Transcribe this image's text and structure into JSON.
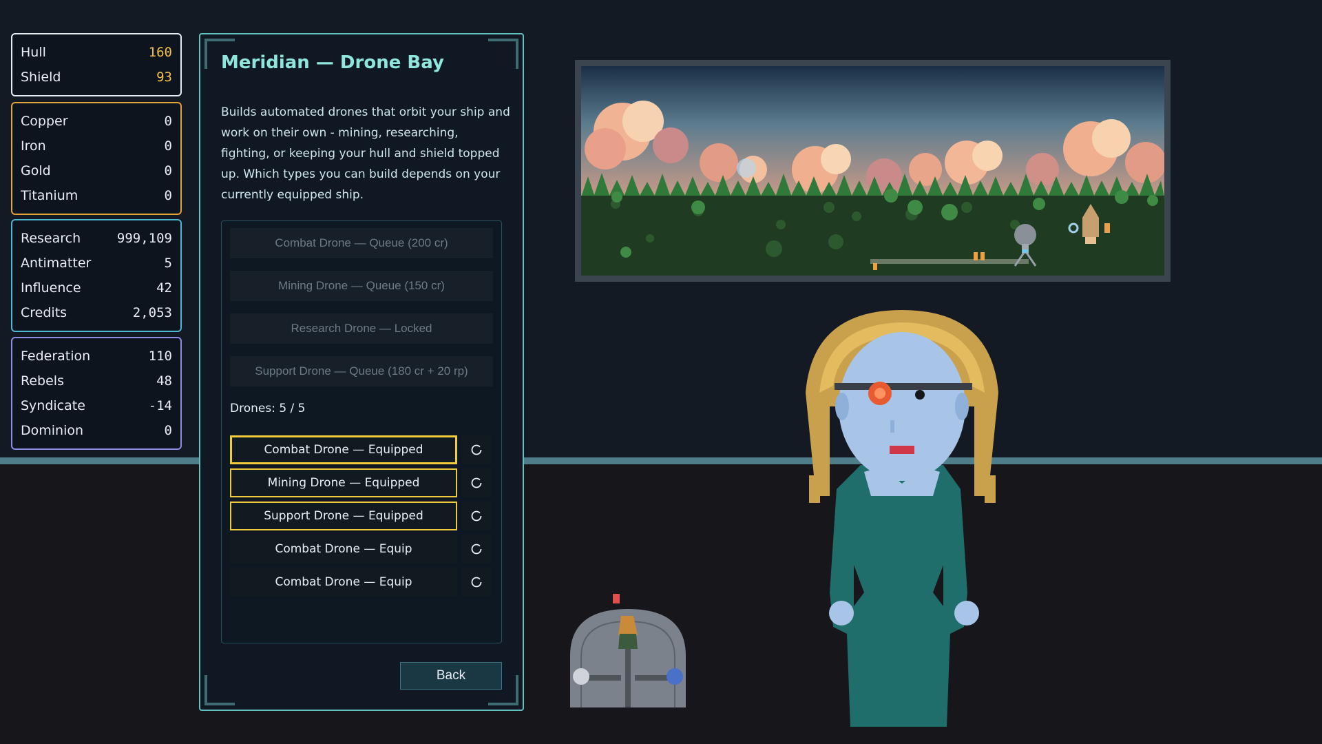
{
  "stats": {
    "hull": [
      {
        "label": "Hull",
        "value": "160"
      },
      {
        "label": "Shield",
        "value": "93"
      }
    ],
    "metals": [
      {
        "label": "Copper",
        "value": "0"
      },
      {
        "label": "Iron",
        "value": "0"
      },
      {
        "label": "Gold",
        "value": "0"
      },
      {
        "label": "Titanium",
        "value": "0"
      }
    ],
    "resources": [
      {
        "label": "Research",
        "value": "999,109"
      },
      {
        "label": "Antimatter",
        "value": "5"
      },
      {
        "label": "Influence",
        "value": "42"
      },
      {
        "label": "Credits",
        "value": "2,053"
      }
    ],
    "factions": [
      {
        "label": "Federation",
        "value": "110"
      },
      {
        "label": "Rebels",
        "value": "48"
      },
      {
        "label": "Syndicate",
        "value": "-14"
      },
      {
        "label": "Dominion",
        "value": "0"
      }
    ]
  },
  "panel": {
    "title": "Meridian — Drone Bay",
    "description": "Builds automated drones that orbit your ship and work on their own - mining, researching, fighting, or keeping your hull and shield topped up. Which types you can build depends on your currently equipped ship.",
    "build_options": [
      "Combat Drone — Queue (200 cr)",
      "Mining Drone — Queue (150 cr)",
      "Research Drone — Locked",
      "Support Drone — Queue (180 cr + 20 rp)"
    ],
    "drones_count": "Drones: 5 / 5",
    "slots": [
      {
        "label": "Combat Drone — Equipped",
        "equipped": true
      },
      {
        "label": "Mining Drone — Equipped",
        "equipped": true
      },
      {
        "label": "Support Drone — Equipped",
        "equipped": true
      },
      {
        "label": "Combat Drone — Equip",
        "equipped": false
      },
      {
        "label": "Combat Drone — Equip",
        "equipped": false
      }
    ],
    "back_label": "Back"
  },
  "icons": {
    "cycle": "cycle-icon"
  },
  "colors": {
    "accent": "#63c2bf",
    "hull_value": "#f2c14c",
    "equipped_border": "#f0cc3c",
    "metals_border": "#e3a23a",
    "resources_border": "#4fb6d6",
    "factions_border": "#8c8ee3"
  }
}
